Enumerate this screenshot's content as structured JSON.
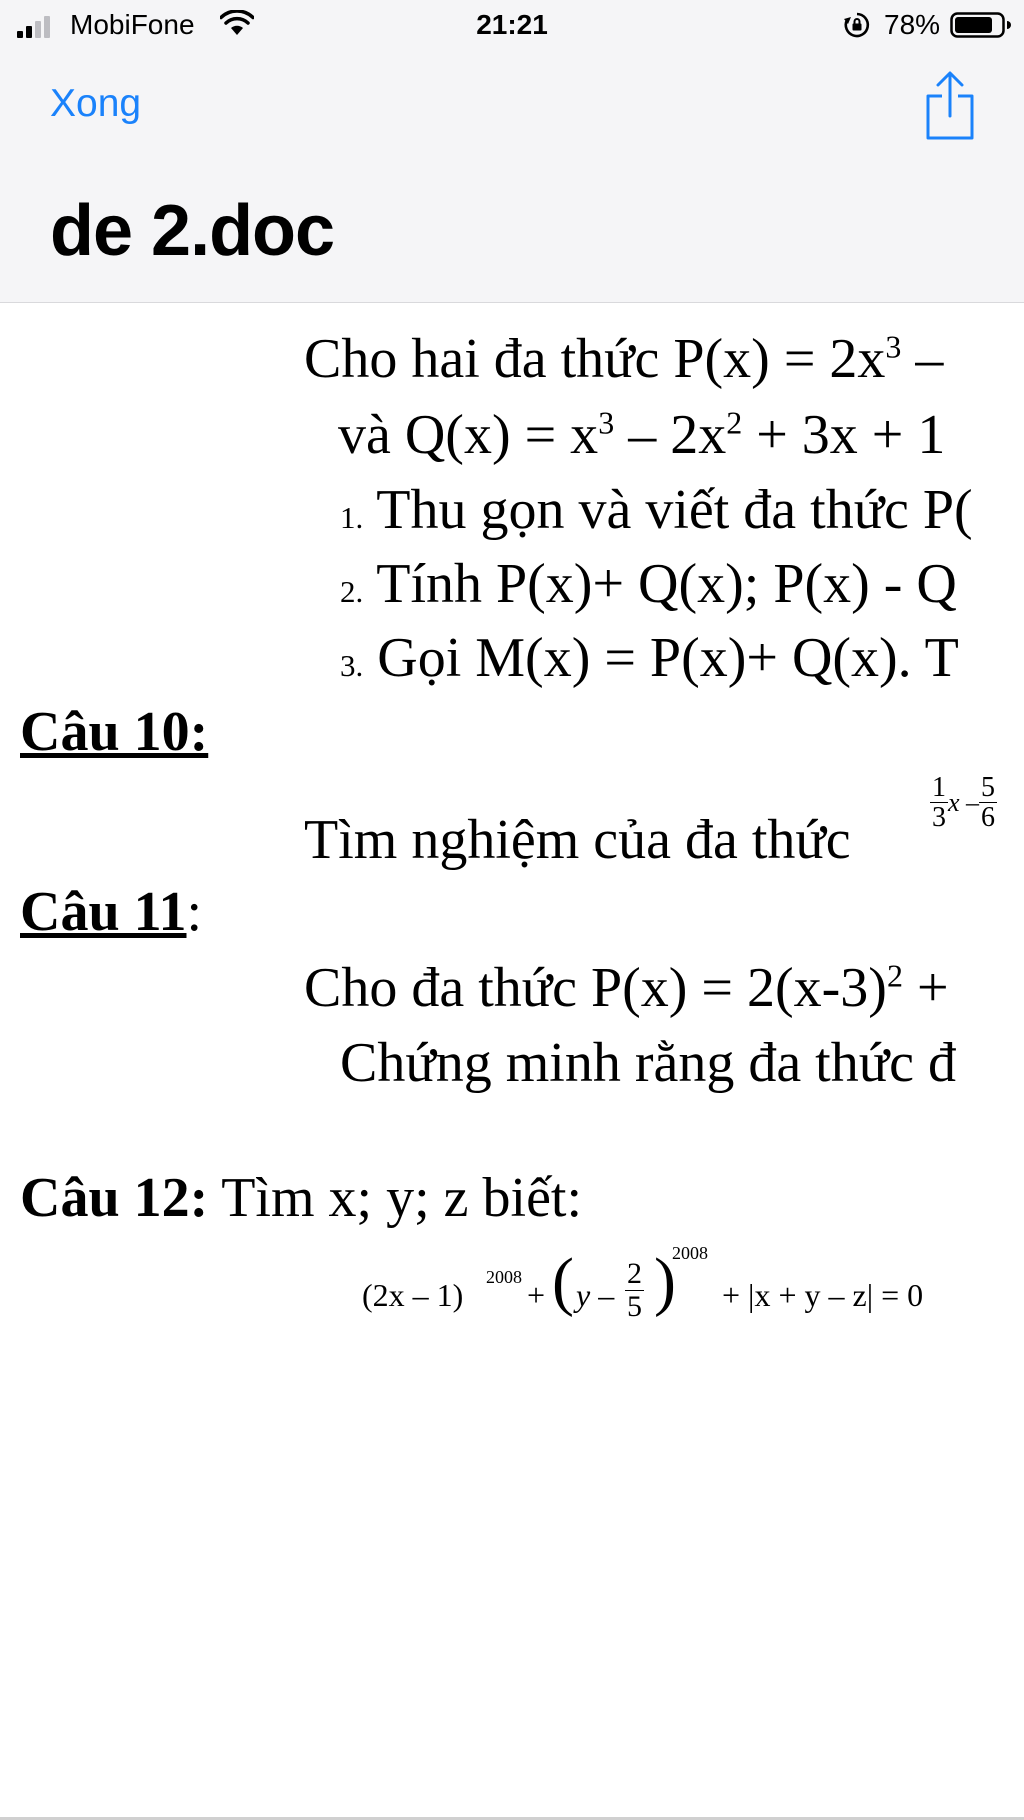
{
  "status_bar": {
    "carrier": "MobiFone",
    "time": "21:21",
    "battery": "78%"
  },
  "nav": {
    "done_label": "Xong",
    "title": "de 2.doc"
  },
  "document": {
    "q9_line1": "Cho hai  đa thức P(x) = 2x",
    "q9_line2a": "và  Q(x) = x",
    "q9_line2b": " – 2x",
    "q9_line2c": " + 3x + 1",
    "q9_i1_num": "1.",
    "q9_i1": "Thu gọn và viết đa thức P(",
    "q9_i2_num": "2.",
    "q9_i2": "Tính P(x)+ Q(x);   P(x) - Q",
    "q9_i3_num": "3.",
    "q9_i3": "Gọi M(x) = P(x)+ Q(x). T",
    "q10_label": "Câu 10:",
    "q10_text": "Tìm nghiệm của đa thức",
    "q11_label": "Câu 11",
    "q11_colon": ":",
    "q11_line1": "Cho đa thức  P(x) = 2(x-3)",
    "q11_line2": "Chứng minh rằng đa thức đ",
    "q12_label": "Câu 12:",
    "q12_text": " Tìm x; y; z biết:",
    "sup3": "3",
    "sup2": "2",
    "exp_2008": "2008",
    "f_1": "1",
    "f_3": "3",
    "f_5": "5",
    "f_6": "6",
    "f_2": "2",
    "f_5b": "5",
    "eq_a": "(2x – 1)",
    "eq_plus1": "+",
    "eq_y": "y –",
    "eq_abs": "+ |x + y – z| = 0",
    "q10_x": "x –"
  }
}
